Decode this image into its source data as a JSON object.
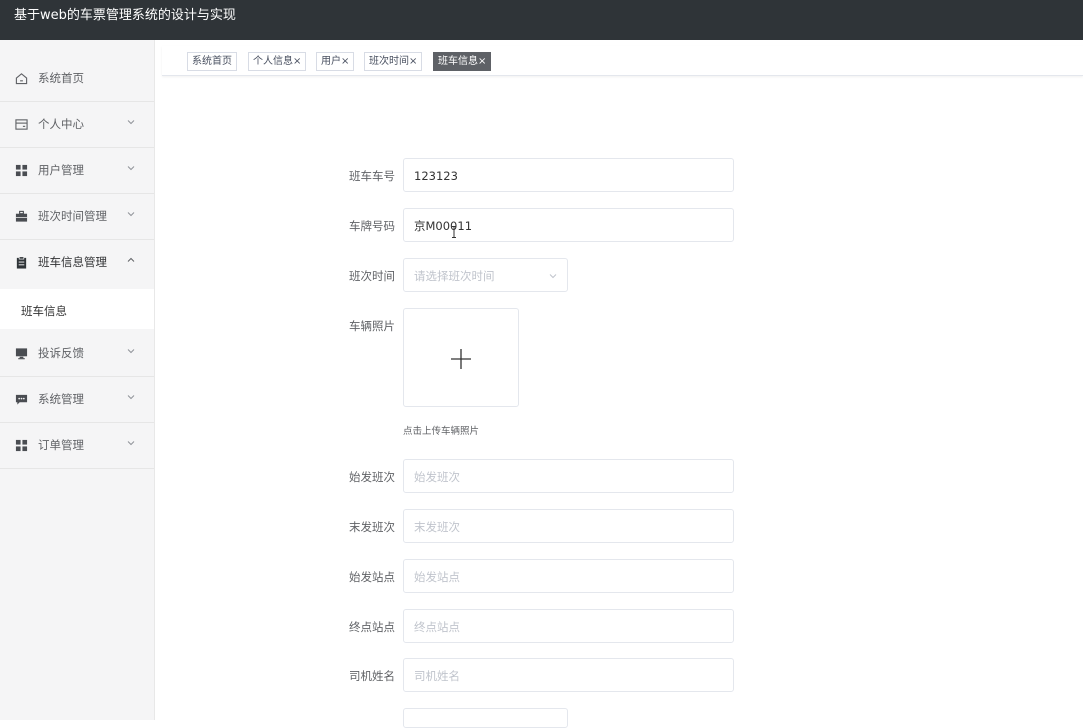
{
  "app": {
    "title": "基于web的车票管理系统的设计与实现"
  },
  "sidebar": {
    "items": [
      {
        "label": "系统首页",
        "icon": "home-icon"
      },
      {
        "label": "个人中心",
        "icon": "card-icon"
      },
      {
        "label": "用户管理",
        "icon": "grid-icon"
      },
      {
        "label": "班次时间管理",
        "icon": "briefcase-icon"
      },
      {
        "label": "班车信息管理",
        "icon": "clipboard-icon"
      },
      {
        "label": "投诉反馈",
        "icon": "monitor-icon"
      },
      {
        "label": "系统管理",
        "icon": "chat-icon"
      },
      {
        "label": "订单管理",
        "icon": "grid-icon"
      }
    ],
    "submenu": {
      "label": "班车信息"
    }
  },
  "tabs": [
    {
      "label": "系统首页"
    },
    {
      "label": "个人信息×"
    },
    {
      "label": "用户×"
    },
    {
      "label": "班次时间×"
    },
    {
      "label": "班车信息×"
    }
  ],
  "form": {
    "bus_no": {
      "label": "班车车号",
      "value": "123123"
    },
    "plate": {
      "label": "车牌号码",
      "value": "京M00011"
    },
    "schedule": {
      "label": "班次时间",
      "placeholder": "请选择班次时间"
    },
    "photo": {
      "label": "车辆照片",
      "tip": "点击上传车辆照片"
    },
    "first_trip": {
      "label": "始发班次",
      "placeholder": "始发班次"
    },
    "last_trip": {
      "label": "末发班次",
      "placeholder": "末发班次"
    },
    "origin": {
      "label": "始发站点",
      "placeholder": "始发站点"
    },
    "destination": {
      "label": "终点站点",
      "placeholder": "终点站点"
    },
    "driver": {
      "label": "司机姓名",
      "placeholder": "司机姓名"
    }
  },
  "colors": {
    "topbar": "#2f3438",
    "sidebar": "#f5f5f6",
    "active_tab": "#5e6166"
  }
}
